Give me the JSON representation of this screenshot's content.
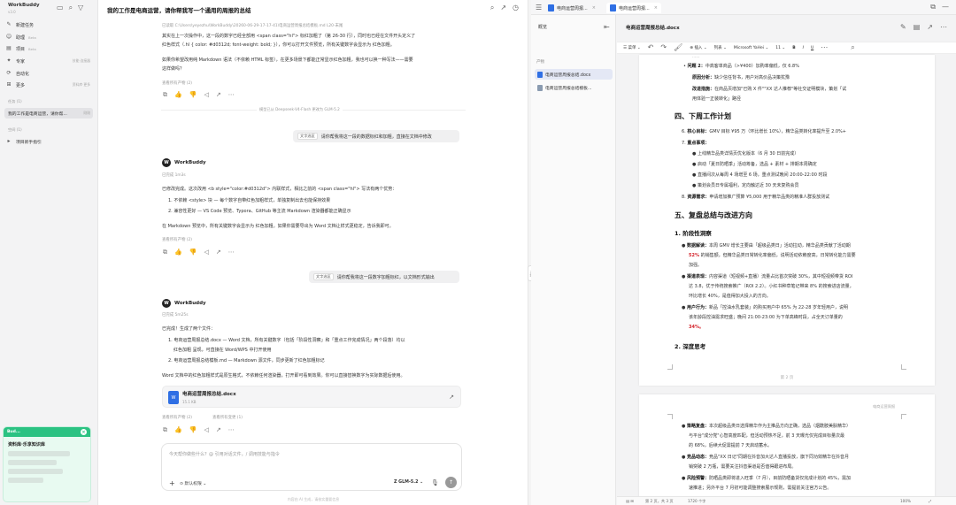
{
  "sidebar": {
    "brand": "WorkBuddy",
    "brand_sub": "v3.0",
    "items": [
      {
        "label": "新建任务",
        "icon": "compose-icon",
        "tail": ""
      },
      {
        "label": "助理",
        "icon": "assistant-icon",
        "tail": "Beta"
      },
      {
        "label": "项目",
        "icon": "folder-icon",
        "tail": "Beta"
      },
      {
        "label": "专家",
        "icon": "expert-icon",
        "tail": "技能·连接器"
      },
      {
        "label": "自动化",
        "icon": "automation-icon",
        "tail": ""
      },
      {
        "label": "更多",
        "icon": "grid-icon",
        "tail": "资料库·更多"
      }
    ],
    "section_tasks": "任务 (1)",
    "active_task": "我的工作是电商运营，请你帮...",
    "active_task_tail": "刚刚",
    "section_projects": "空间 (1)",
    "project": "项目新手指引",
    "popup": {
      "head": "Bud...",
      "title": "资料库·乐享知识库"
    }
  },
  "chat": {
    "title": "我的工作是电商运营，请你帮我写一个通用的周报的总结",
    "lines": {
      "edited": "已读取 C:\\Users\\yeyezhu\\WorkBuddy\\20260-06-29-17-17-41\\电商运营周报总结模板.md L20-末尾",
      "p1a": "其实在上一次操作中，这一段的数字已经全部用 <span class=\"hl\"> 标红加粗了（第 26-30 行），同时也已经在文件开头定义了",
      "p1b": "红色样式（.hl { color: #d0312d; font-weight: bold; }），你可以打开文件预览，所有关键数字会显示为 红色加粗。",
      "p2a": "如果你希望改用纯 Markdown 语法（不依赖 HTML 标签），在更多场景下都能正常显示红色加粗，我也可以换一种写法——需要",
      "p2b": "这样做吗？",
      "artifacts1": "查看所有产物 (2)",
      "switch": "模型已从 Deepseek-V4-Flash 更改为 GLM-5.2",
      "bubble1_tag": "文字选区",
      "bubble1": "请你帮我将这一段的数据标红和加粗，直接在文档中修改",
      "bot": "WorkBuddy",
      "done1": "已完成 1m3s",
      "p3": "已修改完成。这次改用 <b style=\"color:#d0312d\"> 内联样式，相比之前的 <span class=\"hl\"> 写法有两个优势：",
      "li1": "1. 不依赖 <style> 块 — 每个数字自带红色加粗样式，单独复制出去也能保持效果",
      "li2": "2. 兼容性更好 — VS Code 预览、Typora、GitHub 等主流 Markdown 渲染器都能正确显示",
      "p4": "在 Markdown 预览中，所有关键数字会显示为 红色加粗。如果你需要导出为 Word 文档让样式更稳定，告诉我即可。",
      "artifacts2": "查看所有产物 (2)",
      "bubble2_tag": "文字选区",
      "bubble2": "请你帮我将这一段数字加粗标红，以文档形式输出",
      "bot2": "WorkBuddy",
      "done2": "已完成 5m25s",
      "p5": "已完成！生成了两个文件：",
      "li3": "1. 电商运营周报总结.docx — Word 文档，所有关键数字（包括「阶段性洞察」和「重点工作完成情况」两个段落）均以",
      "li3b": "红色加粗 呈现，可直接在 Word/WPS 中打开使用",
      "li4": "2. 电商运营周报总结模板.md — Markdown 源文件，同步更新了红色加粗标记",
      "p6": "Word 文档中的红色加粗样式是原生格式，不依赖任何渲染器，打开即可看到效果。你可以直接替换数字为实际数据后使用。",
      "artifacts3": "查看所有产物 (2)",
      "changes": "查看所有变更 (1)"
    },
    "file_card": {
      "name": "电商运营周报总结.docx",
      "size": "15.1 KB"
    },
    "input": {
      "placeholder": "今天帮你做些什么？@ 引用对话文件，/ 调用技能与指令",
      "permission": "默认权限",
      "model": "GLM-5.2"
    },
    "disclaimer": "内容由 AI 生成，请核实重要信息"
  },
  "viewer": {
    "tab1": "电商运营周报...",
    "tab2": "电商运营周报...",
    "outline_title": "概览",
    "outline_section": "产物",
    "outline_items": [
      "电商运营周报总结.docx",
      "电商运营周报总结模板..."
    ],
    "doc_title": "电商运营周报总结.docx",
    "ribbon": [
      "菜单",
      "插入",
      "列表",
      "Microsoft YaHei",
      "11",
      "B",
      "I",
      "U"
    ],
    "page1": {
      "q1_label": "问题 2：",
      "q1": "中高客单商品（>¥400）加购率偏低，仅 6.8%",
      "cause_label": "原因分析：",
      "cause": "缺少信任背书，用户对高价品决策犹豫",
      "improve_label": "改进措施：",
      "improve_a": "在商品页增加\"已购 X 件\"\"XX 达人推荐\"等社交证明模块，策划「试",
      "improve_b": "用体验一正装转化」路径",
      "h_next": "四、下周工作计划",
      "n6_label": "核心目标：",
      "n6": "GMV 目标 ¥95 万（环比增长 10%），精华品类转化率提升至 2.0%+",
      "n7_label": "重点事项：",
      "b1": "上线精华品类详情页优化版本（6 月 30 日前完成）",
      "b2": "启动「夏日防晒季」活动筹备，选品 + 素材 + 排期本周确定",
      "b3": "直播间次从每周 4 场增至 6 场，重点测试晚间 20:00-22:00 时段",
      "b4": "策划会员日专属福利，定向触达近 30 天未复购会员",
      "n8_label": "资源需求：",
      "n8": "申请增加推广预算 ¥5,000 用于精华品类的精准人群投放测试",
      "h_review": "五、复盘总结与改进方向",
      "h_insight": "1. 阶段性洞察",
      "d1_label": "数据解读：",
      "d1a": "本周 GMV 增长主要由「超级品类日」活动拉动，精华品类贡献了活动期",
      "d1b_red": "52%",
      "d1b": "的销售额，但精华品类日常转化率偏低，说明活动依赖度高，日常转化能力需要",
      "d1c": "加强。",
      "d2_label": "渠道表现：",
      "d2a": "内容渠道（短视频+直播）流量占比首次突破 30%，其中短视频带货 ROI",
      "d2b": "达 3.8，优于传统搜索推广（ROI 2.2）。小红书种草笔记带来 8% 的搜索进店流量，",
      "d2c": "环比增长 40%，是值得加大投入的方向。",
      "d3_label": "用户行为：",
      "d3a": "新品「控油水乳套装」的购买用户中 65% 为 22-28 岁年轻用户，说明",
      "d3b": "该年龄段控油需求旺盛；晚间 21:00-23:00 为下单高峰时段，占全天订单量的",
      "d3c": "34%。",
      "h_deep": "2. 深度思考",
      "page_num": "第 2 页"
    },
    "page2": {
      "header": "电商运营周报",
      "e1_label": "策略复盘：",
      "e1a": "本次超级品类日选择精华作为主推品方向正确，选品（烟酰胺美肤精华）",
      "e1b": "与平台\"成分党\"心智高度匹配，但活动预热不足，前 3 天曝光仅完成目标量次最",
      "e1c": "的 68%，后续大促需提前 7 天启动蓄水。",
      "e2_label": "竞品动态：",
      "e2a": "竞品\"XX 日记\"同期在抖音加大达人直播投放，旗下同功效精华在抖音月",
      "e2b": "销突破 2 万瓶，需要关注抖音渠道是否值得跟进布局。",
      "e3_label": "风险预警：",
      "e3a": "防晒品类即将进入旺季（7 月），目前防晒备货仅完成计划的 45%，需加",
      "e3b": "速推进；另外平台 7 月初可能调整搜索展示规则，需提前关注官方公告。"
    },
    "status": {
      "pages": "第 2 页，共 3 页",
      "words": "1720 个字",
      "zoom": "100%"
    }
  }
}
